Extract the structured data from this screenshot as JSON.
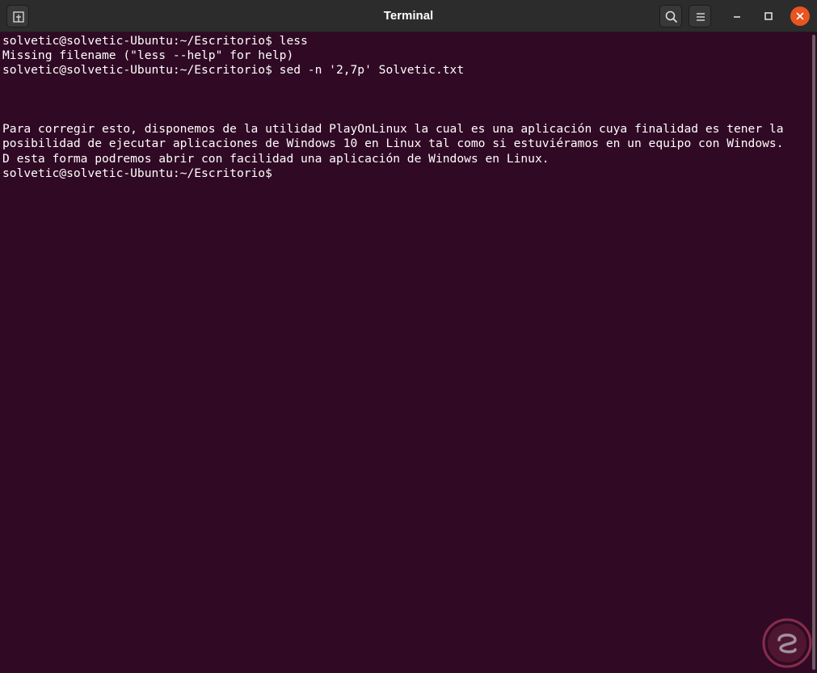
{
  "window": {
    "title": "Terminal"
  },
  "titlebar": {
    "icons": {
      "new_tab": "new-tab-icon",
      "search": "search-icon",
      "menu": "hamburger-menu-icon",
      "minimize": "minimize-icon",
      "maximize": "maximize-icon",
      "close": "close-icon"
    }
  },
  "terminal": {
    "lines": [
      "solvetic@solvetic-Ubuntu:~/Escritorio$ less",
      "Missing filename (\"less --help\" for help)",
      "solvetic@solvetic-Ubuntu:~/Escritorio$ sed -n '2,7p' Solvetic.txt",
      "",
      "",
      "",
      "Para corregir esto, disponemos de la utilidad PlayOnLinux la cual es una aplicación cuya finalidad es tener la",
      "posibilidad de ejecutar aplicaciones de Windows 10 en Linux tal como si estuviéramos en un equipo con Windows.",
      "D esta forma podremos abrir con facilidad una aplicación de Windows en Linux.",
      "solvetic@solvetic-Ubuntu:~/Escritorio$"
    ]
  },
  "colors": {
    "terminal_background": "#300a24",
    "titlebar_background": "#2c2c2c",
    "close_button": "#e95420",
    "text": "#ffffff"
  }
}
